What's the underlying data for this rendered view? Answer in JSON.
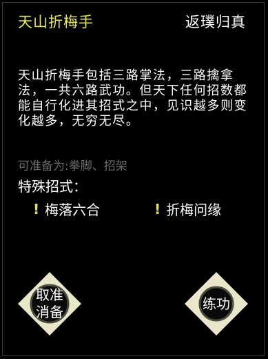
{
  "header": {
    "skill_name": "天山折梅手",
    "realm": "返璞归真"
  },
  "description": "天山折梅手包括三路掌法，三路擒拿法，一共六路武功。但天下任何招数都能自行化进其招式之中，见识越多则变化越多，无穷无尽。",
  "prep_line": "可准备为:拳脚、招架",
  "special": {
    "title": "特殊招式：",
    "moves": [
      {
        "label": "梅落六合",
        "marker": "!"
      },
      {
        "label": "折梅问缘",
        "marker": "!"
      }
    ]
  },
  "buttons": {
    "cancel_prep": "取准\n消备",
    "practice": "练功"
  },
  "colors": {
    "title_yellow": "#ecec32",
    "marker_yellow": "#e8e830",
    "dim_text": "#6b6b6b",
    "button_fill": "#e9e6c9",
    "button_inner": "#0a0a0a"
  }
}
